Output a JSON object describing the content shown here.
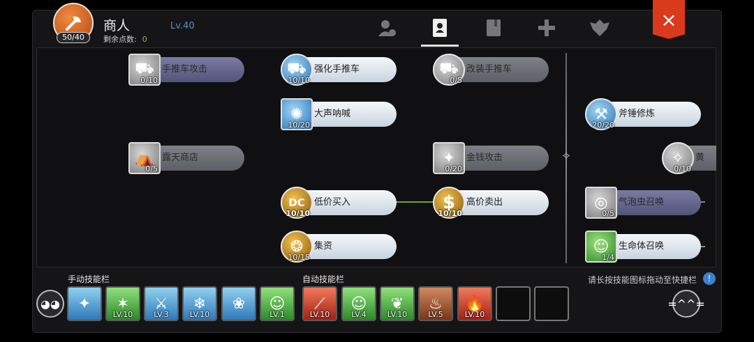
{
  "header": {
    "char_name": "商人",
    "level": "Lv.40",
    "points_label": "剩余点数:",
    "points_value": "0",
    "avatar_count": "50/40",
    "close_label": "×",
    "tabs": [
      "character-tab",
      "skill-book-tab",
      "codex-tab",
      "cross-tab",
      "emblem-tab"
    ],
    "active_tab": 1
  },
  "skills": [
    {
      "name": "手推车攻击",
      "count": "0/10",
      "state": "purple"
    },
    {
      "name": "强化手推车",
      "count": "10/10",
      "state": "active"
    },
    {
      "name": "改装手推车",
      "count": "0/5",
      "state": "disabled"
    },
    {
      "name": "大声呐喊",
      "count": "10/20",
      "state": "active"
    },
    {
      "name": "斧锤修炼",
      "count": "20/20",
      "state": "active"
    },
    {
      "name": "露天商店",
      "count": "0/5",
      "state": "disabled"
    },
    {
      "name": "金钱攻击",
      "count": "0/20",
      "state": "disabled"
    },
    {
      "name": "黄",
      "count": "0/10",
      "state": "disabled"
    },
    {
      "name": "低价买入",
      "count": "10/10",
      "state": "active"
    },
    {
      "name": "高价卖出",
      "count": "10/10",
      "state": "active"
    },
    {
      "name": "气泡虫召唤",
      "count": "0/5",
      "state": "purple"
    },
    {
      "name": "集资",
      "count": "10/15",
      "state": "active"
    },
    {
      "name": "生命体召唤",
      "count": "1/4",
      "state": "active"
    }
  ],
  "bar": {
    "manual_label": "手动技能栏",
    "auto_label": "自动技能栏",
    "hint": "请长按技能图标拖动至快捷栏",
    "info": "!",
    "manual_slots": [
      {
        "lv": ""
      },
      {
        "lv": "LV.10"
      },
      {
        "lv": "LV.3"
      },
      {
        "lv": "LV.10"
      },
      {
        "lv": ""
      },
      {
        "lv": "LV.1"
      }
    ],
    "auto_slots": [
      {
        "lv": "LV.10"
      },
      {
        "lv": "LV.4"
      },
      {
        "lv": "LV.10"
      },
      {
        "lv": "LV.5"
      },
      {
        "lv": "LV.10"
      },
      {
        "lv": ""
      },
      {
        "lv": ""
      }
    ]
  },
  "colors": {
    "accent_green": "#7fc042",
    "close_red": "#d93a1b",
    "level_blue": "#5b8cc8"
  }
}
